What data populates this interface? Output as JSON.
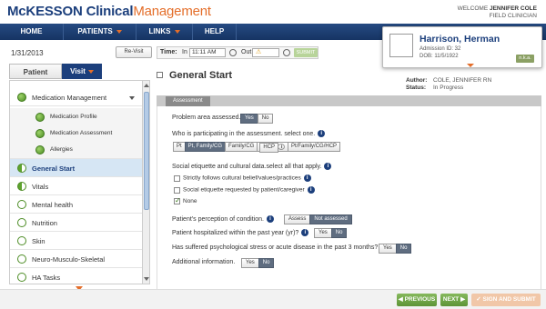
{
  "header": {
    "logo_prefix": "McKESSON",
    "logo_clinical": "Clinical",
    "logo_management": "Management",
    "welcome_text": "WELCOME",
    "user_name": "JENNIFER COLE",
    "user_role": "FIELD CLINICIAN"
  },
  "nav": {
    "items": [
      {
        "label": "HOME",
        "has_caret": false
      },
      {
        "label": "PATIENTS",
        "has_caret": true
      },
      {
        "label": "LINKS",
        "has_caret": true
      },
      {
        "label": "HELP",
        "has_caret": false
      }
    ]
  },
  "patient": {
    "name": "Harrison, Herman",
    "admission_id": "Admission ID: 32",
    "dob": "DOB: 11/5/1922",
    "allergy_badge": "n.k.a."
  },
  "toolbar": {
    "date": "1/31/2013",
    "revisit_label": "Re-Visit",
    "time_label": "Time:",
    "in_label": "In",
    "in_value": "11:11 AM",
    "out_label": "Out",
    "out_warning": "⚠",
    "submit_label": "SUBMIT"
  },
  "sidebar": {
    "tabs": {
      "patient": "Patient",
      "visit": "Visit"
    },
    "items": [
      {
        "label": "Medication Management",
        "status": "green",
        "sub": false,
        "active": false,
        "expandable": true
      },
      {
        "label": "Medication Profile",
        "status": "green",
        "sub": true,
        "active": false
      },
      {
        "label": "Medication Assessment",
        "status": "green",
        "sub": true,
        "active": false
      },
      {
        "label": "Allergies",
        "status": "green",
        "sub": true,
        "active": false
      },
      {
        "label": "General Start",
        "status": "half",
        "sub": false,
        "active": true
      },
      {
        "label": "Vitals",
        "status": "half",
        "sub": false,
        "active": false
      },
      {
        "label": "Mental health",
        "status": "empty",
        "sub": false,
        "active": false
      },
      {
        "label": "Nutrition",
        "status": "empty",
        "sub": false,
        "active": false
      },
      {
        "label": "Skin",
        "status": "empty",
        "sub": false,
        "active": false
      },
      {
        "label": "Neuro-Musculo-Skeletal",
        "status": "empty",
        "sub": false,
        "active": false
      },
      {
        "label": "HA Tasks",
        "status": "empty",
        "sub": false,
        "active": false
      }
    ]
  },
  "main": {
    "title": "General Start",
    "author_label": "Author:",
    "author_value": "COLE, JENNIFER RN",
    "status_label": "Status:",
    "status_value": "In Progress",
    "section_tab": "Assessment",
    "q1": "Problem area assessed.",
    "q1_opts": {
      "yes": "Yes",
      "no": "No"
    },
    "q2": "Who is participating in the assessment. select one.",
    "q2_opts": {
      "pt": "Pt",
      "pt_family_cg": "Pt, Family/CG",
      "family_cg": "Family/CG",
      "hcp": "HCP",
      "pt_family_cg_hcp": "Pt/Family/CG/HCP"
    },
    "q3": "Social etiquette and cultural data.select all that apply.",
    "q3_opts": {
      "strict": "Strictly follows cultural belief/values/practices",
      "requested": "Social etiquette requested by patient/caregiver",
      "none": "None"
    },
    "q4": "Patient's perception of condition.",
    "q4_opts": {
      "assess": "Assess",
      "not_assessed": "Not assessed"
    },
    "q5": "Patient hospitalized within the past year (yr)?",
    "q5_opts": {
      "yes": "Yes",
      "no": "No"
    },
    "q6": "Has suffered psychological stress or acute disease in the past 3 months?",
    "q6_opts": {
      "yes": "Yes",
      "no": "No"
    },
    "q7": "Additional information.",
    "q7_opts": {
      "yes": "Yes",
      "no": "No"
    },
    "info_icon": "i"
  },
  "footer": {
    "previous": "◀ PREVIOUS",
    "next": "NEXT ▶",
    "sign_submit": "✓ SIGN AND SUBMIT"
  }
}
